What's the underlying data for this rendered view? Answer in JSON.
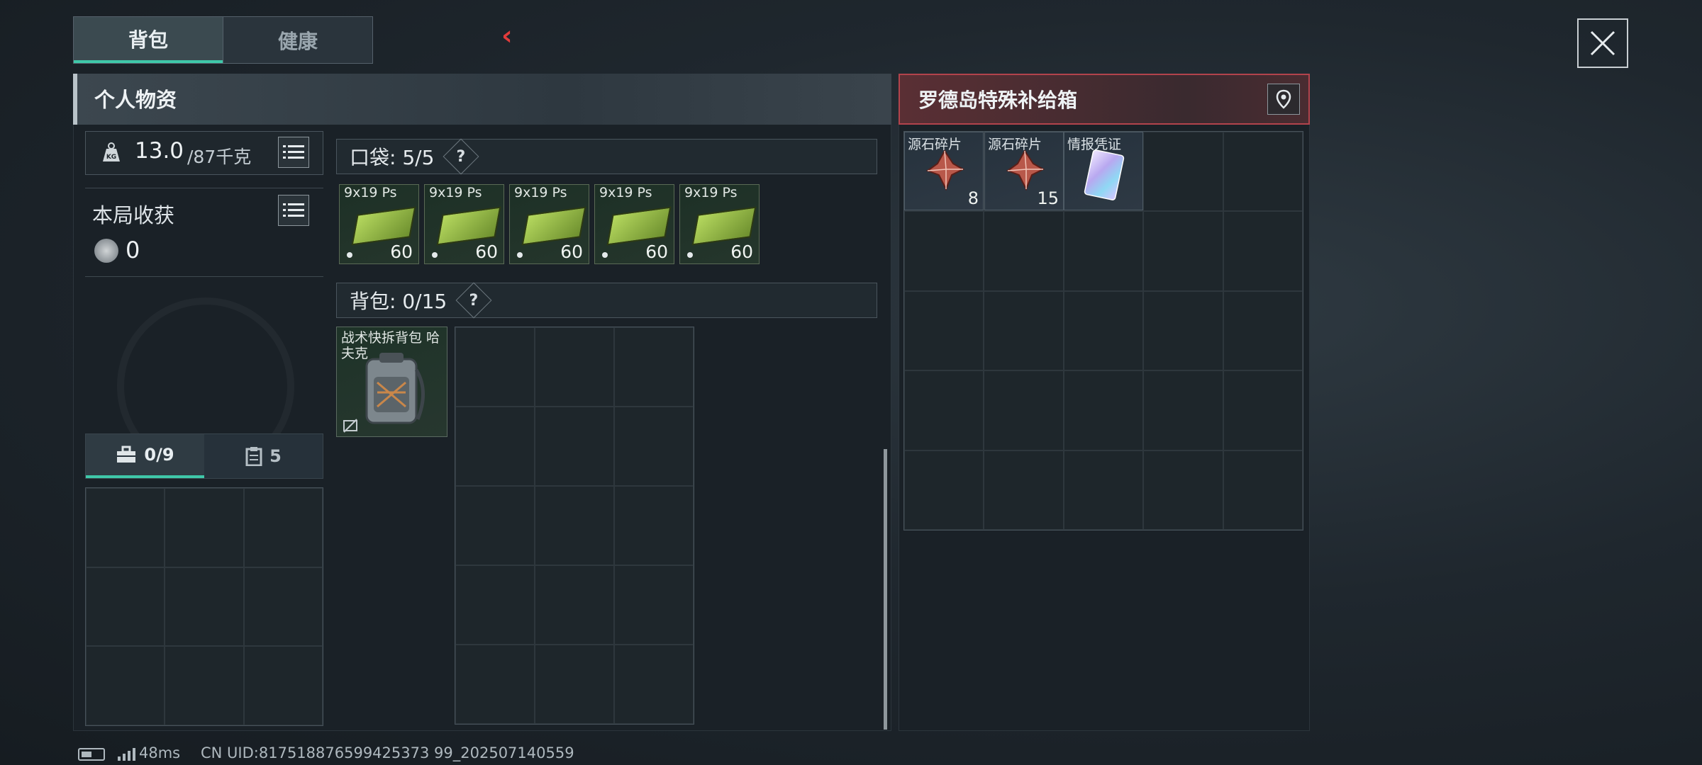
{
  "tabs": [
    {
      "label": "背包",
      "active": true
    },
    {
      "label": "健康",
      "active": false
    }
  ],
  "personal": {
    "title": "个人物资",
    "weight": "13.0",
    "weight_max": "/87千克",
    "harvest_label": "本局收获",
    "harvest_value": "0",
    "sub_tabs": [
      {
        "label": "0/9",
        "icon": "toolbox-icon"
      },
      {
        "label": "5",
        "icon": "clipboard-icon"
      }
    ]
  },
  "pocket": {
    "label": "口袋: 5/5",
    "help": "?",
    "items": [
      {
        "name": "9x19 Ps",
        "count": "60"
      },
      {
        "name": "9x19 Ps",
        "count": "60"
      },
      {
        "name": "9x19 Ps",
        "count": "60"
      },
      {
        "name": "9x19 Ps",
        "count": "60"
      },
      {
        "name": "9x19 Ps",
        "count": "60"
      }
    ]
  },
  "backpack": {
    "label": "背包: 0/15",
    "help": "?",
    "item_name": "战术快拆背包 哈夫克"
  },
  "supply": {
    "title": "罗德岛特殊补给箱",
    "items": [
      {
        "name": "源石碎片",
        "count": "8"
      },
      {
        "name": "源石碎片",
        "count": "15"
      },
      {
        "name": "情报凭证",
        "count": ""
      }
    ]
  },
  "status": {
    "ping": "48ms",
    "uid": "CN UID:817518876599425373 99_202507140559"
  },
  "colors": {
    "accent": "#3fc8a9",
    "danger": "#e23b3b",
    "supply_border": "#b2434c"
  }
}
